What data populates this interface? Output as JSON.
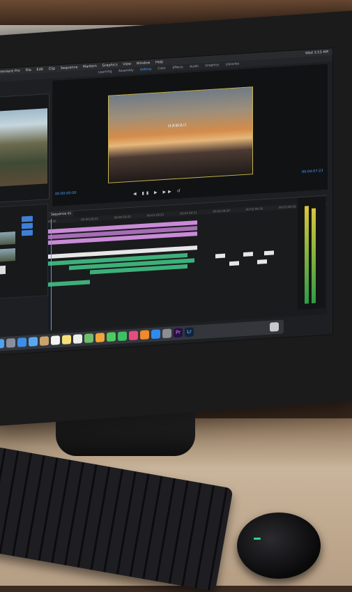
{
  "menubar": {
    "apple": "",
    "items": [
      "Premiere Pro",
      "File",
      "Edit",
      "Clip",
      "Sequence",
      "Markers",
      "Graphics",
      "View",
      "Window",
      "Help"
    ],
    "clock": "Wed 3:53 AM"
  },
  "workspaces": [
    "Learning",
    "Assembly",
    "Editing",
    "Color",
    "Effects",
    "Audio",
    "Graphics",
    "Libraries"
  ],
  "active_workspace": "Editing",
  "source_panel": {
    "title": "Source"
  },
  "program_panel": {
    "title": "Program: Sequence 01",
    "overlay_title": "HAWAII",
    "timecode_left": "00:00:00:00",
    "timecode_right": "00:04:07:23"
  },
  "timeline": {
    "tab": "Sequence 01",
    "ruler": [
      "00:00",
      "00:00:29:23",
      "00:00:59:22",
      "00:01:29:21",
      "00:01:59:21",
      "00:02:29:20",
      "00:02:59:19",
      "00:03:29:18"
    ]
  },
  "dock": {
    "icons": [
      "finder-icon",
      "launchpad-icon",
      "safari-icon",
      "mail-icon",
      "contacts-icon",
      "calendar-icon",
      "notes-icon",
      "reminders-icon",
      "maps-icon",
      "photos-icon",
      "messages-icon",
      "facetime-icon",
      "itunes-icon",
      "ibooks-icon",
      "appstore-icon",
      "preferences-icon",
      "premiere-pro-icon",
      "lightroom-icon",
      "trash-icon"
    ],
    "labels": {
      "premiere": "Pr",
      "lightroom": "Lr"
    }
  },
  "colors": {
    "accent": "#4aa3ff",
    "video_clip": "#c98bd7",
    "audio_clip": "#3db07a"
  }
}
